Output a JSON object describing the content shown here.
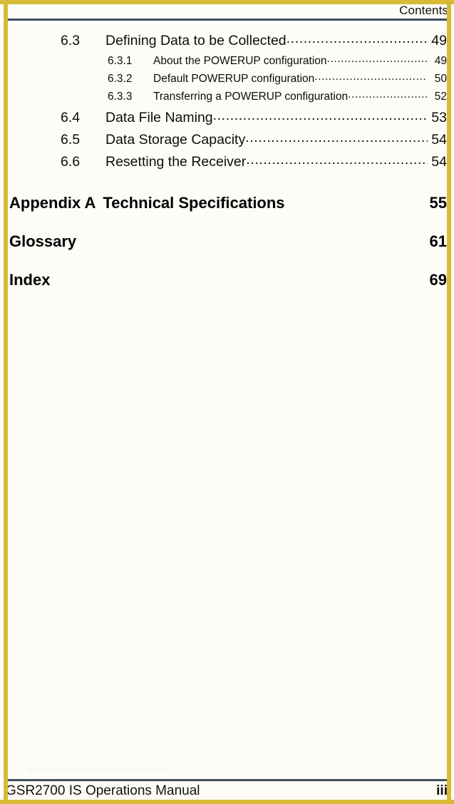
{
  "header": {
    "title": "Contents"
  },
  "toc": {
    "entries": [
      {
        "level": 1,
        "number": "6.3",
        "title": "Defining Data to be Collected",
        "page": "49"
      },
      {
        "level": 2,
        "number": "6.3.1",
        "title": "About the POWERUP configuration",
        "page": "49"
      },
      {
        "level": 2,
        "number": "6.3.2",
        "title": "Default POWERUP configuration",
        "page": "50"
      },
      {
        "level": 2,
        "number": "6.3.3",
        "title": "Transferring a POWERUP configuration",
        "page": "52"
      },
      {
        "level": 1,
        "number": "6.4",
        "title": "Data File Naming",
        "page": "53"
      },
      {
        "level": 1,
        "number": "6.5",
        "title": "Data Storage Capacity ",
        "page": "54"
      },
      {
        "level": 1,
        "number": "6.6",
        "title": "Resetting the Receiver ",
        "page": "54"
      }
    ],
    "major_entries": [
      {
        "label": "Appendix A",
        "title": "Technical Specifications",
        "page": "55"
      },
      {
        "label": "Glossary",
        "title": "",
        "page": "61"
      },
      {
        "label": "Index",
        "title": "",
        "page": "69"
      }
    ]
  },
  "watermark": {
    "text": "www.manualslib.com manuals search engine"
  },
  "footer": {
    "manual_title": "GSR2700 IS Operations Manual",
    "page_number": "iii"
  },
  "colors": {
    "frame": "#d8bb34",
    "rule": "#414c5e",
    "paper": "#fdfcf7",
    "text": "#0d0d0d"
  }
}
